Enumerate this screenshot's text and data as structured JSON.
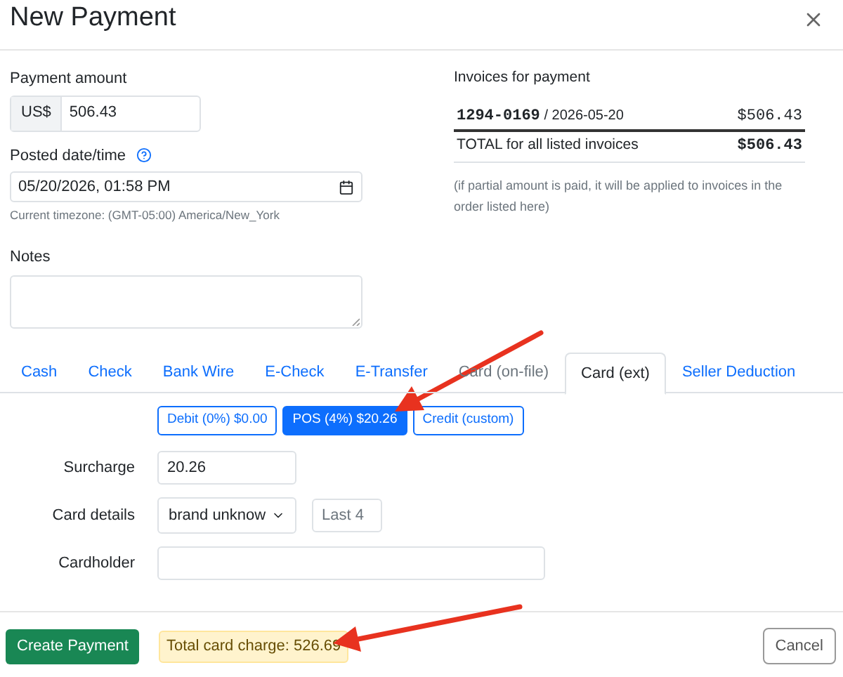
{
  "dialog": {
    "title": "New Payment"
  },
  "payment_amount": {
    "label": "Payment amount",
    "currency": "US$",
    "value": "506.43"
  },
  "posted": {
    "label": "Posted date/time",
    "value": "05/20/2026, 01:58 PM",
    "hint": "Current timezone: (GMT-05:00) America/New_York"
  },
  "notes": {
    "label": "Notes"
  },
  "invoices": {
    "title": "Invoices for payment",
    "rows": [
      {
        "number": "1294-0169",
        "separator": "/",
        "date": "2026-05-20",
        "amount": "$506.43"
      }
    ],
    "total": {
      "label": "TOTAL for all listed invoices",
      "amount": "$506.43"
    },
    "note": "(if partial amount is paid, it will be applied to invoices in the order listed here)"
  },
  "tabs": [
    {
      "label": "Cash",
      "selected": false,
      "disabled": false
    },
    {
      "label": "Check",
      "selected": false,
      "disabled": false
    },
    {
      "label": "Bank Wire",
      "selected": false,
      "disabled": false
    },
    {
      "label": "E-Check",
      "selected": false,
      "disabled": false
    },
    {
      "label": "E-Transfer",
      "selected": false,
      "disabled": false
    },
    {
      "label": "Card (on-file)",
      "selected": false,
      "disabled": true
    },
    {
      "label": "Card (ext)",
      "selected": true,
      "disabled": false
    },
    {
      "label": "Seller Deduction",
      "selected": false,
      "disabled": false
    }
  ],
  "surcharge_options": [
    {
      "label": "Debit (0%) $0.00",
      "selected": false
    },
    {
      "label": "POS (4%) $20.26",
      "selected": true
    },
    {
      "label": "Credit (custom)",
      "selected": false
    }
  ],
  "surcharge": {
    "label": "Surcharge",
    "value": "20.26"
  },
  "card_details": {
    "label": "Card details",
    "brand": "brand unknow",
    "last4_placeholder": "Last 4"
  },
  "cardholder": {
    "label": "Cardholder"
  },
  "footer": {
    "create": "Create Payment",
    "total_charge": "Total card charge: 526.69",
    "cancel": "Cancel"
  }
}
